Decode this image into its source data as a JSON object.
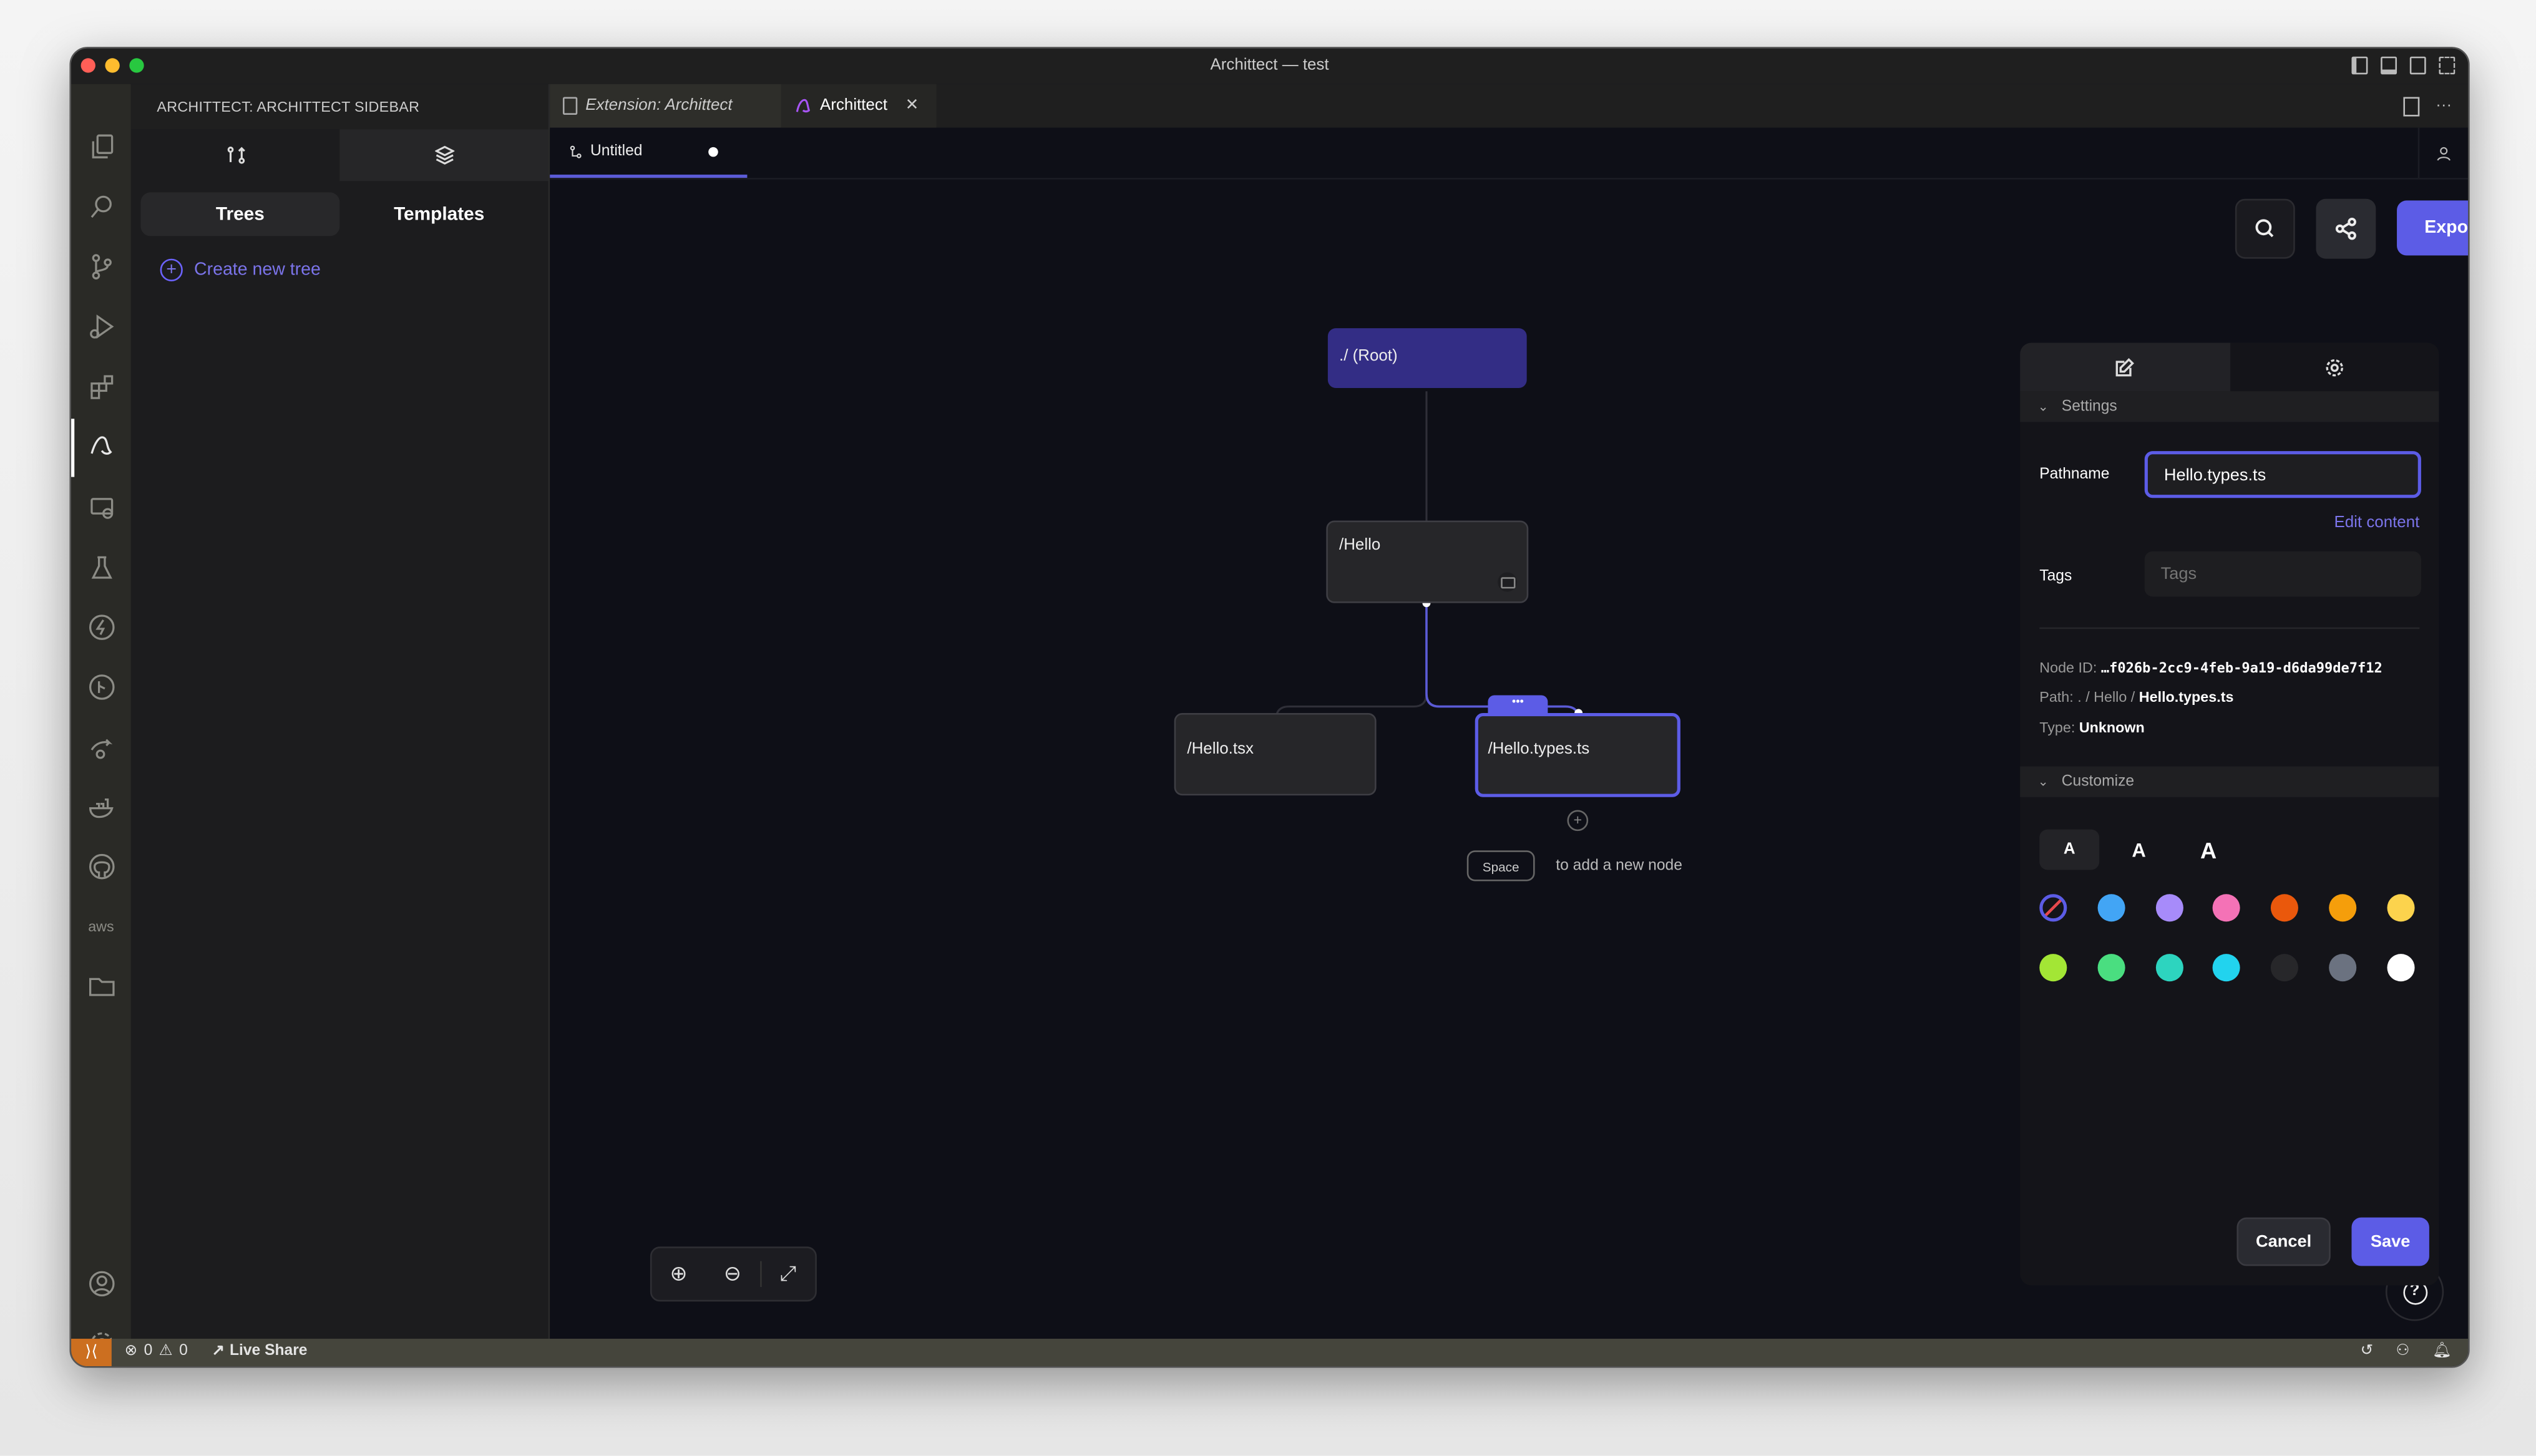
{
  "window": {
    "title": "Archittect — test",
    "traffic_lights": [
      "#ff5f57",
      "#febc2e",
      "#28c840"
    ]
  },
  "activity_bar": {
    "items": [
      {
        "name": "explorer-icon"
      },
      {
        "name": "search-icon"
      },
      {
        "name": "source-control-icon"
      },
      {
        "name": "run-debug-icon"
      },
      {
        "name": "extensions-icon"
      },
      {
        "name": "archittect-icon",
        "active": true
      },
      {
        "name": "remote-explorer-icon"
      },
      {
        "name": "testing-icon"
      },
      {
        "name": "lightning-icon"
      },
      {
        "name": "gitlens-icon"
      },
      {
        "name": "live-share-icon"
      },
      {
        "name": "docker-icon"
      },
      {
        "name": "github-icon"
      },
      {
        "name": "aws-icon"
      },
      {
        "name": "folder-icon"
      }
    ],
    "bottom": [
      {
        "name": "account-icon"
      },
      {
        "name": "manage-gear-icon"
      }
    ]
  },
  "sidebar": {
    "title": "ARCHITTECT: ARCHITTECT SIDEBAR",
    "segments": [
      {
        "label": "Trees",
        "active": true
      },
      {
        "label": "Templates",
        "active": false
      }
    ],
    "create_label": "Create new tree"
  },
  "tabs": [
    {
      "label": "Extension: Archittect",
      "italic": true
    },
    {
      "label": "Archittect",
      "active": true,
      "closable": true
    }
  ],
  "editor": {
    "subtab": {
      "label": "Untitled",
      "dirty": true
    },
    "toolbar": {
      "export_label": "Export"
    },
    "nodes": [
      {
        "id": "root",
        "label": "./ (Root)"
      },
      {
        "id": "hello",
        "label": "/Hello"
      },
      {
        "id": "hello-tsx",
        "label": "/Hello.tsx"
      },
      {
        "id": "hello-types",
        "label": "/Hello.types.ts",
        "selected": true
      }
    ],
    "hint": {
      "key": "Space",
      "text": "to add a new node"
    },
    "node_menu_label": "•••"
  },
  "panel": {
    "settings_section": "Settings",
    "pathname_label": "Pathname",
    "pathname_value": "Hello.types.ts",
    "edit_content_label": "Edit content",
    "tags_label": "Tags",
    "tags_placeholder": "Tags",
    "node_id_label": "Node ID:",
    "node_id_value": "…f026b-2cc9-4feb-9a19-d6da99de7f12",
    "path_label": "Path:",
    "path_prefix": ". / Hello / ",
    "path_current": "Hello.types.ts",
    "type_label": "Type:",
    "type_value": "Unknown",
    "customize_section": "Customize",
    "font_sizes": [
      {
        "label": "A",
        "selected": true
      },
      {
        "label": "A"
      },
      {
        "label": "A"
      }
    ],
    "colors": [
      "none",
      "#42a5f5",
      "#a78bfa",
      "#f472b6",
      "#ea580c",
      "#f59e0b",
      "#fcd34d",
      "#a3e635",
      "#4ade80",
      "#2dd4bf",
      "#22d3ee",
      "#27272a",
      "#6b7280",
      "#ffffff"
    ],
    "cancel_label": "Cancel",
    "save_label": "Save"
  },
  "statusbar": {
    "errors": "0",
    "warnings": "0",
    "live_share": "Live Share"
  },
  "accent": "#5c5ce6"
}
